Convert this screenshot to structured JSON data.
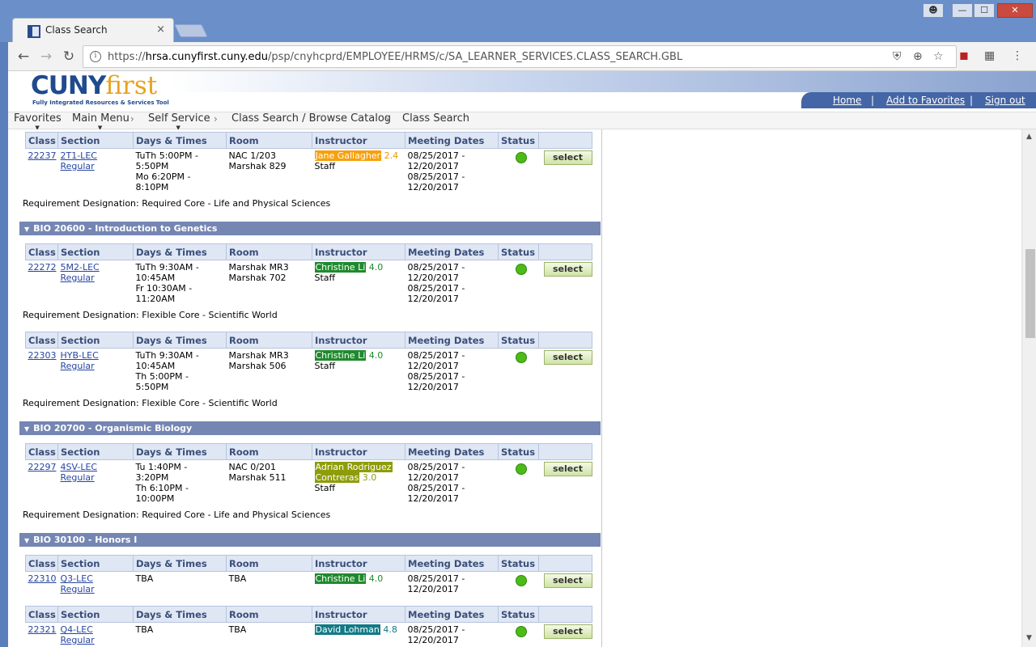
{
  "browser": {
    "tab_title": "Class Search",
    "tab_close": "×",
    "url_prefix": "https://",
    "url_host": "hrsa.cunyfirst.cuny.edu",
    "url_path": "/psp/cnyhcprd/EMPLOYEE/HRMS/c/SA_LEARNER_SERVICES.CLASS_SEARCH.GBL",
    "window_buttons": {
      "minimize": "—",
      "maximize": "☐",
      "close": "✕"
    }
  },
  "header": {
    "logo_main": "CUNY",
    "logo_accent": "first",
    "logo_tagline": "Fully Integrated Resources & Services Tool",
    "links": {
      "home": "Home",
      "favorites": "Add to Favorites",
      "signout": "Sign out"
    },
    "sep": "|"
  },
  "breadcrumb": {
    "favorites": "Favorites",
    "main_menu": "Main Menu",
    "self_service": "Self Service",
    "class_search_browse": "Class Search / Browse Catalog",
    "class_search": "Class Search",
    "sep": "›"
  },
  "table_headers": {
    "class": "Class",
    "section": "Section",
    "days_times": "Days & Times",
    "room": "Room",
    "instructor": "Instructor",
    "meeting_dates": "Meeting Dates",
    "status": "Status"
  },
  "select_label": "select",
  "courses": {
    "bio206": "BIO 20600 - Introduction to Genetics",
    "bio207": "BIO 20700 - Organismic Biology",
    "bio301": "BIO 30100 - Honors I"
  },
  "sections": {
    "s22237": {
      "class": "22237",
      "section": "2T1-LEC",
      "type": "Regular",
      "days": [
        "TuTh 5:00PM -",
        "5:50PM",
        "Mo 6:20PM -",
        "8:10PM"
      ],
      "rooms": [
        "NAC 1/203",
        "Marshak 829"
      ],
      "instructor": "Jane Gallagher",
      "rating": "2.4",
      "instructor2": "Staff",
      "dates": [
        "08/25/2017 -",
        "12/20/2017",
        "08/25/2017 -",
        "12/20/2017"
      ],
      "req": "Requirement Designation: Required Core - Life and Physical Sciences"
    },
    "s22272": {
      "class": "22272",
      "section": "5M2-LEC",
      "type": "Regular",
      "days": [
        "TuTh 9:30AM -",
        "10:45AM",
        "Fr 10:30AM -",
        "11:20AM"
      ],
      "rooms": [
        "Marshak MR3",
        "Marshak 702"
      ],
      "instructor": "Christine Li",
      "rating": "4.0",
      "instructor2": "Staff",
      "dates": [
        "08/25/2017 -",
        "12/20/2017",
        "08/25/2017 -",
        "12/20/2017"
      ],
      "req": "Requirement Designation: Flexible Core - Scientific World"
    },
    "s22303": {
      "class": "22303",
      "section": "HYB-LEC",
      "type": "Regular",
      "days": [
        "TuTh 9:30AM -",
        "10:45AM",
        "Th 5:00PM -",
        "5:50PM"
      ],
      "rooms": [
        "Marshak MR3",
        "Marshak 506"
      ],
      "instructor": "Christine Li",
      "rating": "4.0",
      "instructor2": "Staff",
      "dates": [
        "08/25/2017 -",
        "12/20/2017",
        "08/25/2017 -",
        "12/20/2017"
      ],
      "req": "Requirement Designation: Flexible Core - Scientific World"
    },
    "s22297": {
      "class": "22297",
      "section": "4SV-LEC",
      "type": "Regular",
      "days": [
        "Tu 1:40PM -",
        "3:20PM",
        "Th 6:10PM -",
        "10:00PM"
      ],
      "rooms": [
        "NAC 0/201",
        "Marshak 511"
      ],
      "instructor_line1": "Adrian Rodriguez",
      "instructor_line2": "Contreras",
      "rating": "3.0",
      "instructor2": "Staff",
      "dates": [
        "08/25/2017 -",
        "12/20/2017",
        "08/25/2017 -",
        "12/20/2017"
      ],
      "req": "Requirement Designation: Required Core - Life and Physical Sciences"
    },
    "s22310": {
      "class": "22310",
      "section": "Q3-LEC",
      "type": "Regular",
      "days": [
        "TBA"
      ],
      "rooms": [
        "TBA"
      ],
      "instructor": "Christine Li",
      "rating": "4.0",
      "dates": [
        "08/25/2017 -",
        "12/20/2017"
      ]
    },
    "s22321": {
      "class": "22321",
      "section": "Q4-LEC",
      "type": "Regular",
      "days": [
        "TBA"
      ],
      "rooms": [
        "TBA"
      ],
      "instructor": "David Lohman",
      "rating": "4.8",
      "dates": [
        "08/25/2017 -",
        "12/20/2017"
      ]
    }
  },
  "colors": {
    "course_header": "#7586b3",
    "rating_orange": "#f7a10c",
    "rating_green": "#1f8a2d",
    "rating_olive": "#8e9c0a",
    "rating_teal": "#117a86",
    "status_open": "#4cbb17"
  },
  "icons": {
    "status": "green-circle-open-icon",
    "info": "info-icon",
    "back": "arrow-left-icon",
    "forward": "arrow-right-icon",
    "reload": "reload-icon"
  }
}
